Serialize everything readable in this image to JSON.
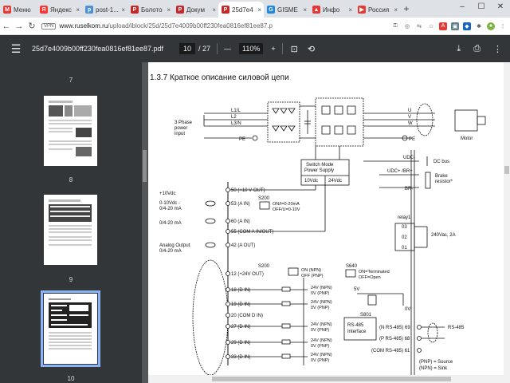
{
  "tabs": [
    {
      "label": "Меню",
      "color": "#e53935",
      "glyph": "М"
    },
    {
      "label": "Яндекс",
      "color": "#ff3333",
      "glyph": "Я"
    },
    {
      "label": "post-1...",
      "color": "#4a90d9",
      "glyph": "p"
    },
    {
      "label": "Болото",
      "color": "#c62828",
      "glyph": "P"
    },
    {
      "label": "Докум",
      "color": "#c62828",
      "glyph": "P"
    },
    {
      "label": "25d7e4",
      "color": "#c62828",
      "glyph": "P"
    },
    {
      "label": "GISME",
      "color": "#1e88e5",
      "glyph": "G"
    },
    {
      "label": "Инфо",
      "color": "#e53935",
      "glyph": "▲"
    },
    {
      "label": "Россия",
      "color": "#e53935",
      "glyph": "▶"
    }
  ],
  "address": {
    "vpn": "VPN",
    "domain": "www.ruselkom.ru",
    "path": "/upload/iblock/25d/25d7e4009b00ff230fea0816ef81ee87.p"
  },
  "pdf": {
    "filename": "25d7e4009b00ff230fea0816ef81ee87.pdf",
    "page": "10",
    "total": "/ 27",
    "zoom": "110%"
  },
  "thumbs": [
    {
      "num": "7"
    },
    {
      "num": "8"
    },
    {
      "num": "9"
    },
    {
      "num": "10"
    }
  ],
  "doc": {
    "heading": "1.3.7  Краткое описание силовой цепи",
    "labels": {
      "phase_in": [
        "3 Phase",
        "power",
        "input"
      ],
      "l1": "L1/L",
      "l2": "L2",
      "l3": "L3/N",
      "pe": "PE",
      "smps": [
        "Switch Mode",
        "Power Supply"
      ],
      "v10": "10Vdc",
      "v24": "24Vdc",
      "u": "U",
      "v": "V",
      "w": "W",
      "pe2": "PE",
      "motor": "Motor",
      "udc_minus": "UDC-",
      "udc_plus": "UDC+ /BR+",
      "br_minus": "BR-",
      "dc_bus": "DC bus",
      "brake": [
        "Brake",
        "resistor*"
      ],
      "plus10": "+10Vdc",
      "t50": "50 (+10 V OUT)",
      "s200": "S200",
      "on_off1": [
        "ON/I=0-20mA",
        "OFF/U=0-10V"
      ],
      "in1": [
        "0-10Vdc -",
        "0/4-20 mA"
      ],
      "t53": "53 (A IN)",
      "in2": "0/4-20 mA",
      "t60": "60 (A IN)",
      "t55": "55 (COM A IN/OUT)",
      "aout": [
        "Analog Output",
        "0/4-20 mA"
      ],
      "t42": "42 (A OUT)",
      "relay": "relay1",
      "r03": "03",
      "r02": "02",
      "r01": "01",
      "rating": "240Vac, 2A",
      "t12": "12 (+24V OUT)",
      "s200b": "S200",
      "on_off2": [
        "ON (NPN)",
        "OFF (PNP)"
      ],
      "s640": "S640",
      "on_off3": [
        "ON=Terminated",
        "OFF=Open"
      ],
      "t18": "18 (D IN)",
      "t19": "19 (D IN)",
      "t20": "20 (COM D IN)",
      "t27": "27 (D IN)",
      "t29": "29 (D IN)",
      "t33": "33 (D IN)",
      "npn": "24V (NPN)",
      "pnp": "0V (PNP)",
      "v5": "5V",
      "v0": "0V",
      "s801": "S801",
      "rs485if": [
        "RS-485",
        "Interface"
      ],
      "t69": "(N RS-485) 69",
      "t68": "(P RS-485) 68",
      "t61": "(COM RS-485) 61",
      "rs485": "RS-485",
      "legend": [
        "(PNP) = Source",
        "(NPN) = Sink"
      ]
    }
  }
}
